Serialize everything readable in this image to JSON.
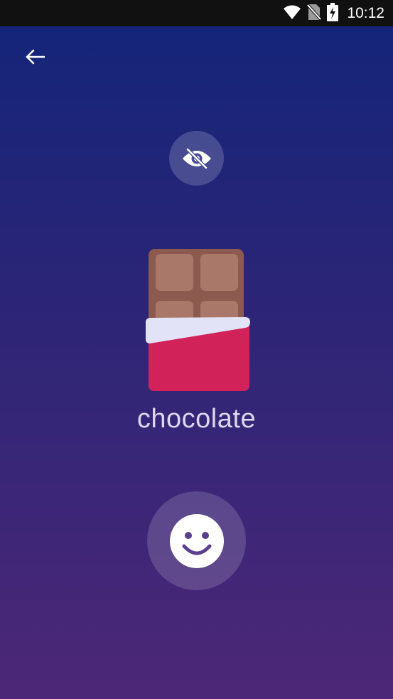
{
  "status_bar": {
    "time": "10:12",
    "icons": [
      "wifi-icon",
      "no-sim-icon",
      "battery-charging-icon"
    ]
  },
  "navigation": {
    "back_icon": "arrow-left-icon"
  },
  "toggle": {
    "icon": "eye-off-icon"
  },
  "item": {
    "word": "chocolate",
    "illustration": "chocolate-bar-icon"
  },
  "action": {
    "icon": "smiley-face-icon"
  },
  "colors": {
    "background_top": "#12257a",
    "background_bottom": "#4d2777",
    "chocolate": "#8d5a4f",
    "chocolate_square": "#a97868",
    "wrapper": "#d1235a",
    "foil": "#e2e3f7",
    "label_text": "#dcd7f2"
  }
}
